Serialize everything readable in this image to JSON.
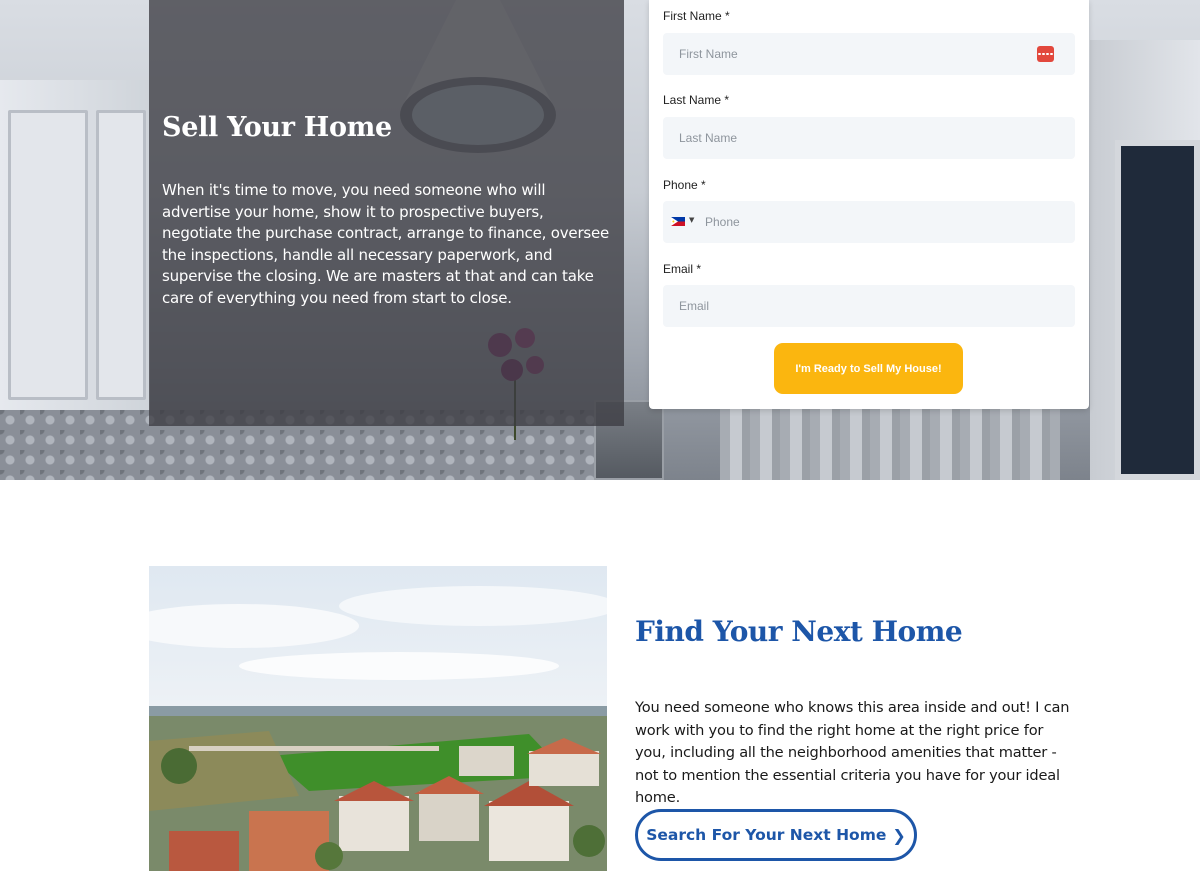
{
  "hero": {
    "title": "Sell Your Home",
    "body": "When it's time to move, you need someone who will advertise your home, show it to prospective buyers, negotiate the purchase contract, arrange to finance, oversee the inspections, handle all necessary paperwork, and supervise the closing. We are masters at that and can take care of everything you need from start to close."
  },
  "form": {
    "first_name": {
      "label": "First Name *",
      "placeholder": "First Name",
      "value": ""
    },
    "last_name": {
      "label": "Last Name *",
      "placeholder": "Last Name",
      "value": ""
    },
    "phone": {
      "label": "Phone *",
      "placeholder": "Phone",
      "value": "",
      "country_flag_icon": "philippines-flag-icon"
    },
    "email": {
      "label": "Email *",
      "placeholder": "Email",
      "value": ""
    },
    "submit_label": "I'm Ready to Sell My House!",
    "accent_color": "#fbb60f"
  },
  "find": {
    "title": "Find Your Next Home",
    "body": "You need someone who knows this area inside and out! I can work with you to find the right home at the right price for you, including all the neighborhood amenities that matter - not to mention the essential criteria you have for your ideal home.",
    "button_label": "Search For Your Next Home",
    "button_icon": "chevron-right-icon",
    "accent_color": "#1d56a8"
  }
}
